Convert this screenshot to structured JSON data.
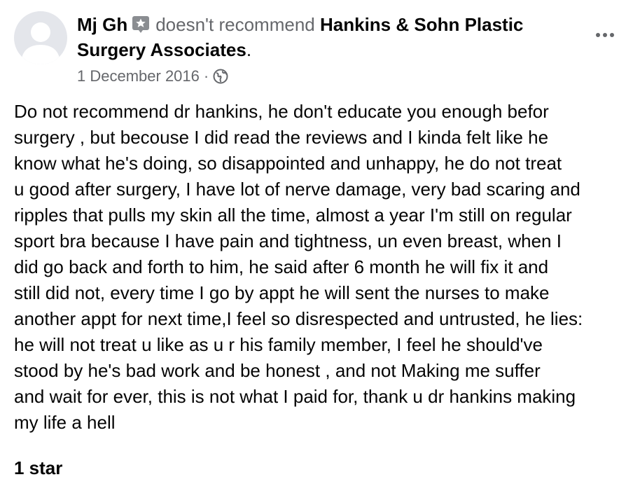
{
  "post": {
    "author": "Mj Gh",
    "action": "doesn't recommend",
    "page_name": "Hankins & Sohn Plastic Surgery Associates",
    "punctuation": ".",
    "date": "1 December 2016",
    "separator": "·",
    "audience_icon": "globe-icon",
    "badge_icon": "star-badge-icon",
    "review_text": "Do not recommend dr hankins, he don't educate you enough befor\nsurgery , but becouse I did read the reviews and I kinda felt like he\nknow what he's doing, so disappointed and unhappy, he do not treat\nu good after surgery, I have lot of nerve damage, very bad scaring and\nripples that pulls my skin all the time,  almost a year I'm still on regular\nsport bra because I have pain and tightness, un even breast, when I\ndid go back and forth to him, he said after 6 month he will fix it and\nstill did not, every time I go by appt he will sent the nurses to make\nanother appt for next time,I feel so disrespected and untrusted, he lies:\nhe will not treat u like as u r his family member, I feel he should've\nstood by he's bad work and be honest , and not Making  me suffer\nand wait for ever, this is not what I paid for, thank u dr hankins making\nmy life a hell",
    "rating": "1 star"
  },
  "colors": {
    "text_primary": "#050505",
    "text_secondary": "#65676b",
    "avatar_bg": "#e4e6eb",
    "avatar_fg": "#ffffff"
  }
}
